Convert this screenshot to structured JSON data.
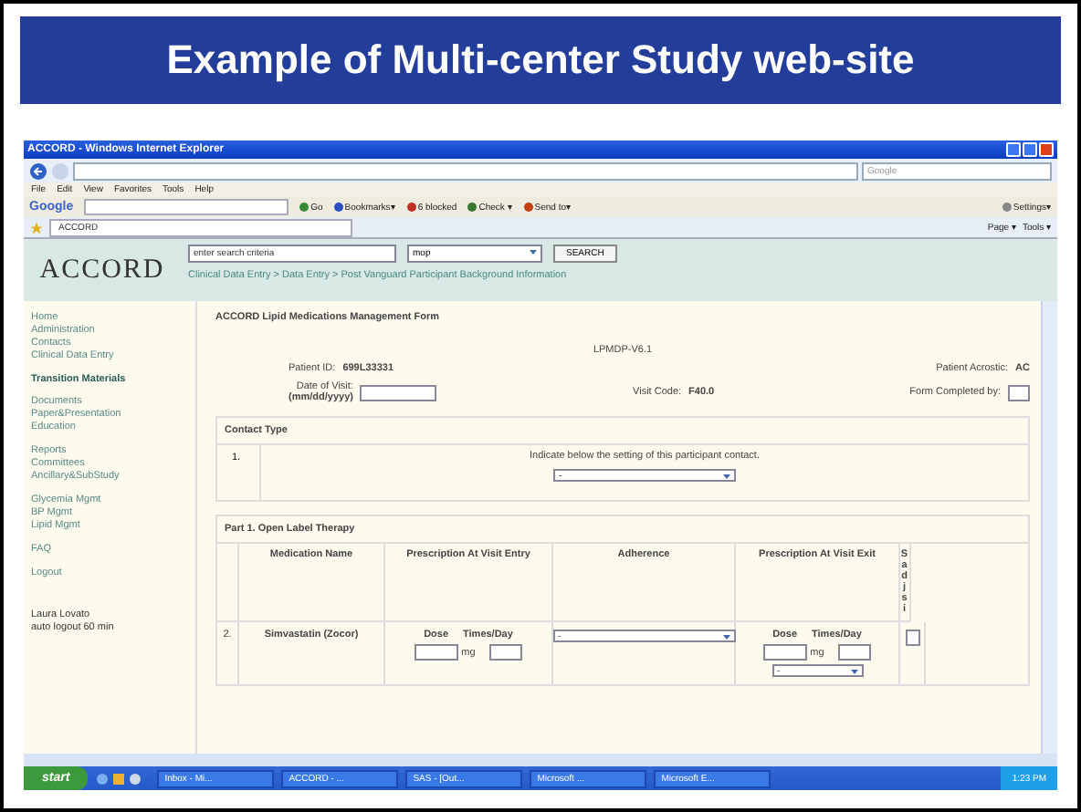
{
  "slide": {
    "title": "Example of Multi-center Study web-site"
  },
  "browser": {
    "title": "ACCORD - Windows Internet Explorer",
    "search_placeholder": "Google",
    "menu": [
      "File",
      "Edit",
      "View",
      "Favorites",
      "Tools",
      "Help"
    ],
    "toolbar": [
      {
        "label": "Google",
        "kind": "brand"
      },
      {
        "label": "Go",
        "kind": "button"
      },
      {
        "label": "Bookmarks▾",
        "kind": "star"
      },
      {
        "label": "6 blocked",
        "kind": "block"
      },
      {
        "label": "Check ▾",
        "kind": "check"
      },
      {
        "label": "Send to▾",
        "kind": "send"
      },
      {
        "label": "Settings▾",
        "kind": "gear"
      }
    ],
    "tab": "ACCORD",
    "commands": [
      "Page ▾",
      "Tools ▾"
    ]
  },
  "site": {
    "logo": "ACCORD",
    "search_value": "enter search criteria",
    "scope": "mop",
    "search_button": "SEARCH",
    "breadcrumb": "Clinical Data Entry > Data Entry > Post Vanguard Participant Background Information",
    "nav": [
      [
        {
          "label": "Home",
          "kind": "link"
        },
        {
          "label": "Administration",
          "kind": "link"
        },
        {
          "label": "Contacts",
          "kind": "link"
        },
        {
          "label": "Clinical Data Entry",
          "kind": "link"
        }
      ],
      [
        {
          "label": "Transition Materials",
          "kind": "heading"
        }
      ],
      [
        {
          "label": "Documents",
          "kind": "link"
        },
        {
          "label": "Paper&Presentation",
          "kind": "link"
        },
        {
          "label": "Education",
          "kind": "link"
        }
      ],
      [
        {
          "label": "Reports",
          "kind": "link"
        },
        {
          "label": "Committees",
          "kind": "link"
        },
        {
          "label": "Ancillary&SubStudy",
          "kind": "link"
        }
      ],
      [
        {
          "label": "Glycemia Mgmt",
          "kind": "link"
        },
        {
          "label": "BP Mgmt",
          "kind": "link"
        },
        {
          "label": "Lipid Mgmt",
          "kind": "link"
        }
      ],
      [
        {
          "label": "FAQ",
          "kind": "link"
        }
      ],
      [
        {
          "label": "Logout",
          "kind": "link"
        }
      ]
    ],
    "user": "Laura Lovato",
    "logout_note": "auto logout 60 min"
  },
  "form": {
    "title": "ACCORD Lipid Medications Management Form",
    "code": "LPMDP-V6.1",
    "patient_id_label": "Patient ID:",
    "patient_id": "699L33331",
    "acrostic_label": "Patient Acrostic:",
    "acrostic": "AC",
    "visit_date_label": "Date of Visit:",
    "visit_date_format": "(mm/dd/yyyy)",
    "visit_code_label": "Visit Code:",
    "visit_code": "F40.0",
    "completed_by_label": "Form Completed by:",
    "contact": {
      "heading": "Contact Type",
      "number": "1.",
      "prompt": "Indicate below the setting of this participant contact.",
      "select": "-"
    },
    "part1": {
      "heading": "Part 1. Open Label Therapy",
      "columns": [
        "Medication Name",
        "Prescription At Visit Entry",
        "Adherence",
        "Prescription At Visit Exit",
        "S adj si"
      ],
      "row": {
        "number": "2.",
        "medication": "Simvastatin (Zocor)",
        "dose": "Dose",
        "times": "Times/Day",
        "unit": "mg",
        "adherence": "-",
        "exit_dose": "Dose",
        "exit_times": "Times/Day",
        "exit_unit": "mg",
        "exit_select": "-"
      }
    }
  },
  "taskbar": {
    "start": "start",
    "tasks": [
      "Inbox - Mi...",
      "ACCORD - ...",
      "SAS - [Out...",
      "Microsoft ...",
      "Microsoft E..."
    ],
    "clock": "1:23 PM"
  }
}
